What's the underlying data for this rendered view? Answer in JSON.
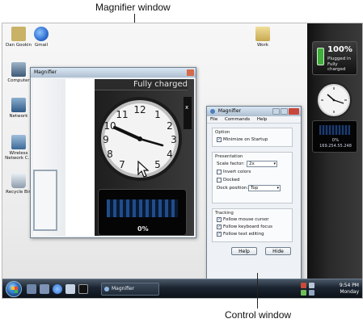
{
  "callouts": {
    "magnifier_window": "Magnifier window",
    "control_window": "Control window"
  },
  "desktop_icons": [
    {
      "label": "Dan Gookin",
      "icon": "folder-user-icon",
      "color": "#c9b267"
    },
    {
      "label": "Gmail",
      "icon": "internet-explorer-icon",
      "color": "#2f6fd0"
    },
    {
      "label": "Computer",
      "icon": "computer-icon",
      "color": "#5d7a9a"
    },
    {
      "label": "Network",
      "icon": "network-icon",
      "color": "#3f6f9a"
    },
    {
      "label": "Wireless Network C...",
      "icon": "wireless-network-icon",
      "color": "#4e7ba8"
    },
    {
      "label": "Recycle Bin",
      "icon": "recycle-bin-icon",
      "color": "#9aaab8"
    },
    {
      "label": "Work",
      "icon": "folder-icon",
      "color": "#d9c27a"
    }
  ],
  "sidebar": {
    "battery": {
      "percent": "100%",
      "line1": "Plugged in",
      "line2": "Fully charged",
      "color": "#3fae3a"
    },
    "cpu": {
      "percent": "0%",
      "address": "169.254.55.248"
    }
  },
  "magnifier_window": {
    "title": "Magnifier",
    "banner_text": "Fully charged",
    "percent_label": "0%",
    "close_glyph": "x"
  },
  "control_window": {
    "title": "Magnifier",
    "menu": [
      "File",
      "Commands",
      "Help"
    ],
    "option_group": {
      "title": "Option",
      "minimize_label": "Minimize on Startup",
      "minimize_checked": true
    },
    "presentation_group": {
      "title": "Presentation",
      "scale_label": "Scale factor:",
      "scale_value": "2x",
      "invert_label": "Invert colors",
      "invert_checked": false,
      "docked_label": "Docked",
      "docked_checked": false,
      "dock_label": "Dock position:",
      "dock_value": "Top"
    },
    "tracking_group": {
      "title": "Tracking",
      "items": [
        {
          "label": "Follow mouse cursor",
          "checked": true
        },
        {
          "label": "Follow keyboard focus",
          "checked": true
        },
        {
          "label": "Follow text editing",
          "checked": true
        }
      ]
    },
    "help_button": "Help",
    "hide_button": "Hide"
  },
  "taskbar": {
    "task_label": "Magnifier",
    "time": "9:54 PM",
    "day": "Monday"
  }
}
